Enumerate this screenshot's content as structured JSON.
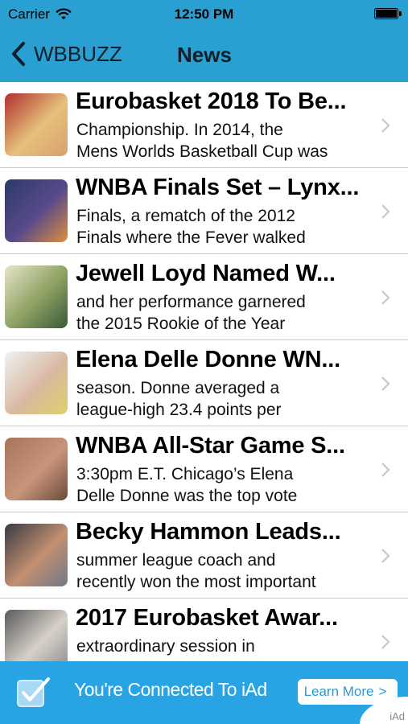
{
  "status_bar": {
    "carrier": "Carrier",
    "time": "12:50 PM"
  },
  "nav": {
    "back_label": "WBBUZZ",
    "title": "News"
  },
  "articles": [
    {
      "title": "Eurobasket 2018 To Be...",
      "line1": "Championship. In 2014, the",
      "line2": "Mens Worlds Basketball Cup was",
      "thumb_colors": [
        "#b03030",
        "#e6c07a",
        "#d8a070"
      ]
    },
    {
      "title": "WNBA Finals Set – Lynx...",
      "line1": "Finals, a rematch of the 2012",
      "line2": "Finals where the Fever walked",
      "thumb_colors": [
        "#2a3a6a",
        "#5a4a8a",
        "#e0903a"
      ]
    },
    {
      "title": "Jewell Loyd Named W...",
      "line1": "and her performance garnered",
      "line2": "the 2015 Rookie of the Year",
      "thumb_colors": [
        "#e8e4c8",
        "#8aa060",
        "#3a5a3a"
      ]
    },
    {
      "title": "Elena Delle Donne WN...",
      "line1": "season. Donne averaged a",
      "line2": "league-high 23.4 points per",
      "thumb_colors": [
        "#eef2f4",
        "#d9b8a0",
        "#e0d06a"
      ]
    },
    {
      "title": "WNBA All-Star Game S...",
      "line1": "3:30pm E.T. Chicago’s Elena",
      "line2": "Delle Donne was the top vote",
      "thumb_colors": [
        "#a9745a",
        "#c8957a",
        "#6a4a3a"
      ]
    },
    {
      "title": "Becky Hammon Leads...",
      "line1": "summer league coach and",
      "line2": "recently won the most important",
      "thumb_colors": [
        "#3a3a42",
        "#c29070",
        "#707888"
      ]
    },
    {
      "title": "2017 Eurobasket Awar...",
      "line1": "extraordinary session in",
      "line2": "",
      "thumb_colors": [
        "#5a5a5a",
        "#d6d0c8",
        "#8a8a8a"
      ]
    }
  ],
  "ad": {
    "text": "You're Connected To iAd",
    "button": "Learn More",
    "button_arrow": ">",
    "mark": "iAd"
  },
  "colors": {
    "nav_bg": "#2a9fd1",
    "ad_bg": "#28a4e4"
  }
}
